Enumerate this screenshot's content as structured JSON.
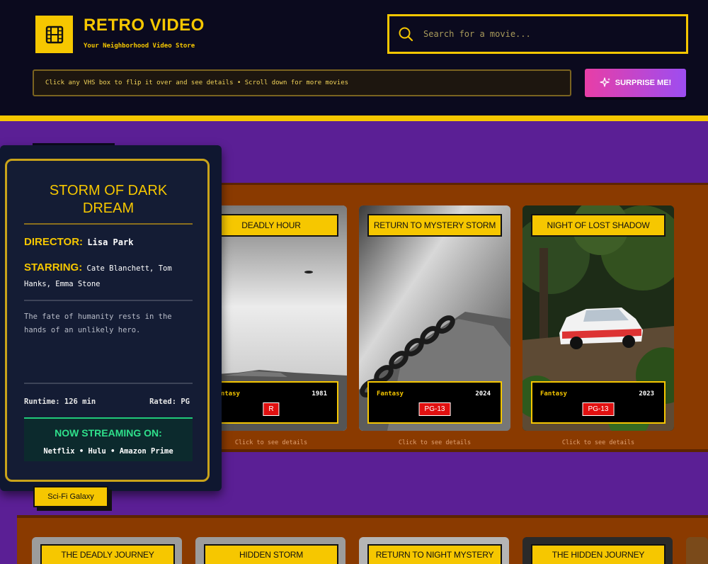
{
  "header": {
    "title": "RETRO VIDEO",
    "subtitle": "Your Neighborhood Video Store",
    "search_placeholder": "Search for a movie...",
    "hint": "Click any VHS box to flip it over and see details • Scroll down for more movies",
    "surprise_label": "SURPRISE ME!"
  },
  "colors": {
    "accent": "#f6c700",
    "background": "#5b1f95",
    "header_bg": "#0b0a1e",
    "shelf": "#8a3a00",
    "rating_badge": "#e01010",
    "streaming": "#2fe08b"
  },
  "detail_card": {
    "title": "STORM OF DARK DREAM",
    "director_label": "DIRECTOR:",
    "director": "Lisa Park",
    "starring_label": "STARRING:",
    "starring": "Cate Blanchett, Tom Hanks, Emma Stone",
    "synopsis": "The fate of humanity rests in the hands of an unlikely hero.",
    "runtime": "Runtime: 126 min",
    "rated": "Rated: PG",
    "streaming_heading": "NOW STREAMING ON:",
    "streaming_services": "Netflix • Hulu • Amazon Prime"
  },
  "genre_tab": "Sci-Fi Galaxy",
  "shelf1": {
    "tapes": [
      {
        "title": "DEADLY HOUR",
        "genre": "Fantasy",
        "year": "1981",
        "rating": "R",
        "hint": "Click to see details"
      },
      {
        "title": "RETURN TO MYSTERY STORM",
        "genre": "Fantasy",
        "year": "2024",
        "rating": "PG-13",
        "hint": "Click to see details"
      },
      {
        "title": "NIGHT OF LOST SHADOW",
        "genre": "Fantasy",
        "year": "2023",
        "rating": "PG-13",
        "hint": "Click to see details"
      }
    ]
  },
  "shelf2": {
    "tapes": [
      {
        "title": "THE DEADLY JOURNEY"
      },
      {
        "title": "HIDDEN STORM"
      },
      {
        "title": "RETURN TO NIGHT MYSTERY"
      },
      {
        "title": "THE HIDDEN JOURNEY"
      }
    ]
  }
}
